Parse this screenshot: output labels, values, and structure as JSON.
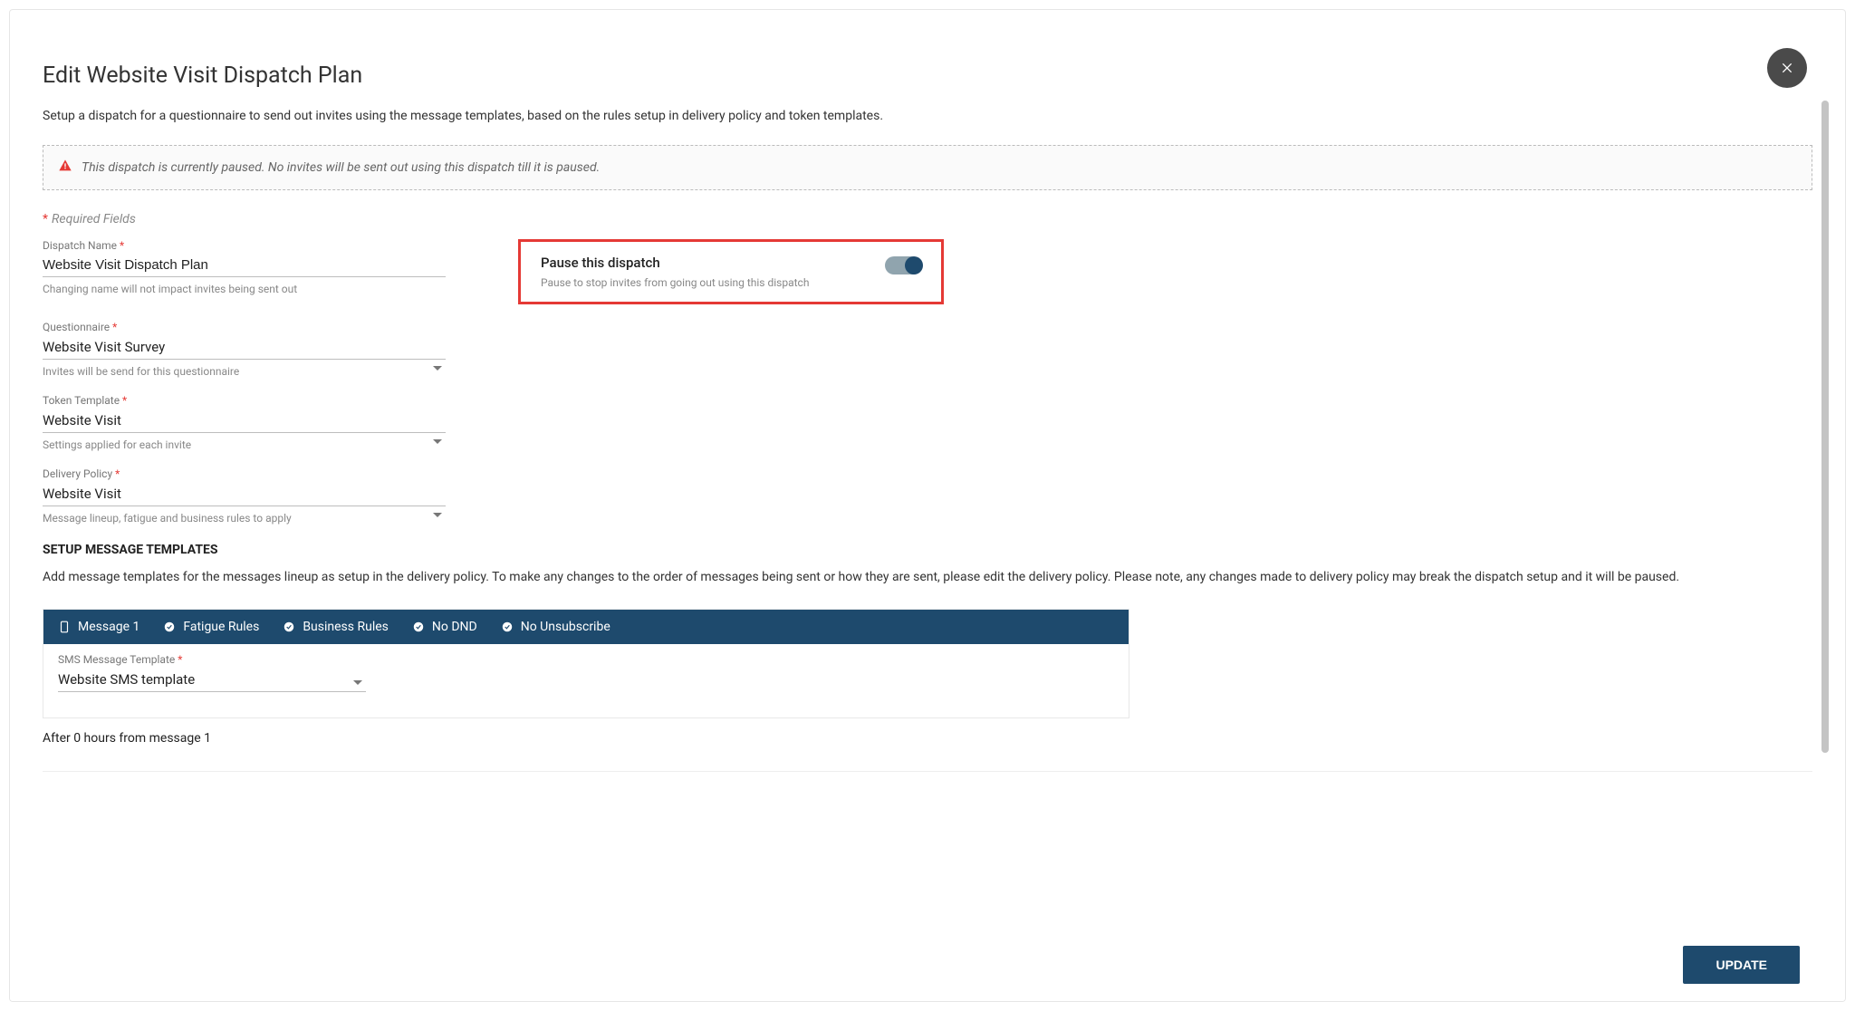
{
  "header": {
    "title": "Edit Website Visit Dispatch Plan",
    "subtitle": "Setup a dispatch for a questionnaire to send out invites using the message templates, based on the rules setup in delivery policy and token templates."
  },
  "alert": {
    "message": "This dispatch is currently paused. No invites will be sent out using this dispatch till it is paused."
  },
  "required_legend": "Required Fields",
  "fields": {
    "dispatch_name": {
      "label": "Dispatch Name",
      "value": "Website Visit Dispatch Plan",
      "help": "Changing name will not impact invites being sent out"
    },
    "questionnaire": {
      "label": "Questionnaire",
      "value": "Website Visit Survey",
      "help": "Invites will be send for this questionnaire"
    },
    "token_template": {
      "label": "Token Template",
      "value": "Website Visit",
      "help": "Settings applied for each invite"
    },
    "delivery_policy": {
      "label": "Delivery Policy",
      "value": "Website Visit",
      "help": "Message lineup, fatigue and business rules to apply"
    }
  },
  "pause": {
    "title": "Pause this dispatch",
    "help": "Pause to stop invites from going out using this dispatch",
    "on": true
  },
  "templates_section": {
    "title": "SETUP MESSAGE TEMPLATES",
    "description": "Add message templates for the messages lineup as setup in the delivery policy. To make any changes to the order of messages being sent or how they are sent, please edit the delivery policy. Please note, any changes made to delivery policy may break the dispatch setup and it will be paused."
  },
  "message_card": {
    "chips": {
      "name": "Message 1",
      "fatigue": "Fatigue Rules",
      "business": "Business Rules",
      "dnd": "No DND",
      "unsub": "No Unsubscribe"
    },
    "sms_template": {
      "label": "SMS Message Template",
      "value": "Website SMS template"
    }
  },
  "after_line": "After 0 hours from message 1",
  "footer": {
    "update_label": "UPDATE"
  }
}
